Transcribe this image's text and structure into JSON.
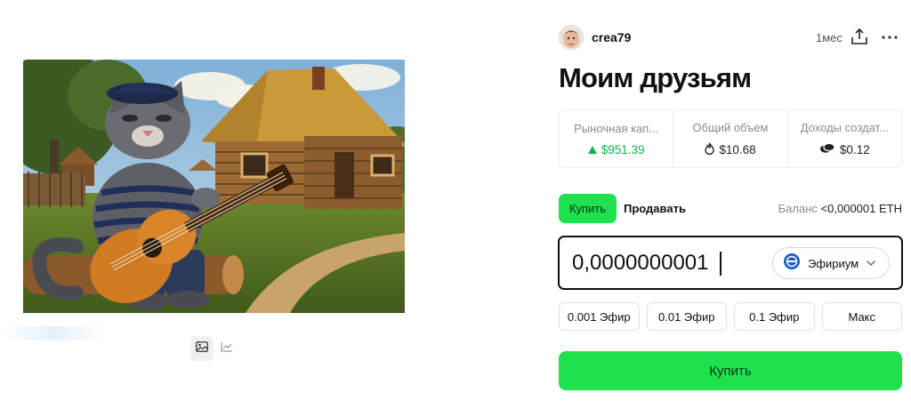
{
  "post": {
    "username": "crea79",
    "time_ago": "1мес",
    "title": "Моим друзьям"
  },
  "stats": [
    {
      "label": "Рыночная капитализация",
      "display_label": "Рыночная кап...",
      "value": "$951.39",
      "icon": "triangle-up-icon"
    },
    {
      "label": "Общий объем",
      "display_label": "Общий объем",
      "value": "$10.68",
      "icon": "fire-icon"
    },
    {
      "label": "Доходы создателя",
      "display_label": "Доходы создат...",
      "value": "$0.12",
      "icon": "coins-icon"
    }
  ],
  "trade": {
    "buy_tab": "Купить",
    "sell_tab": "Продавать",
    "balance_label": "Баланс",
    "balance_value": "<0,000001 ETH",
    "amount_value": "0,0000000001",
    "currency": "Эфириум",
    "presets": [
      "0.001 Эфир",
      "0.01 Эфир",
      "0.1 Эфир",
      "Макс"
    ],
    "buy_button": "Купить"
  },
  "media": {
    "toggle_icons": [
      "image-icon",
      "chart-icon"
    ]
  },
  "colors": {
    "accent_green": "#1fe14e",
    "positive": "#18b14a",
    "ethereum": "#1b5fc9"
  }
}
